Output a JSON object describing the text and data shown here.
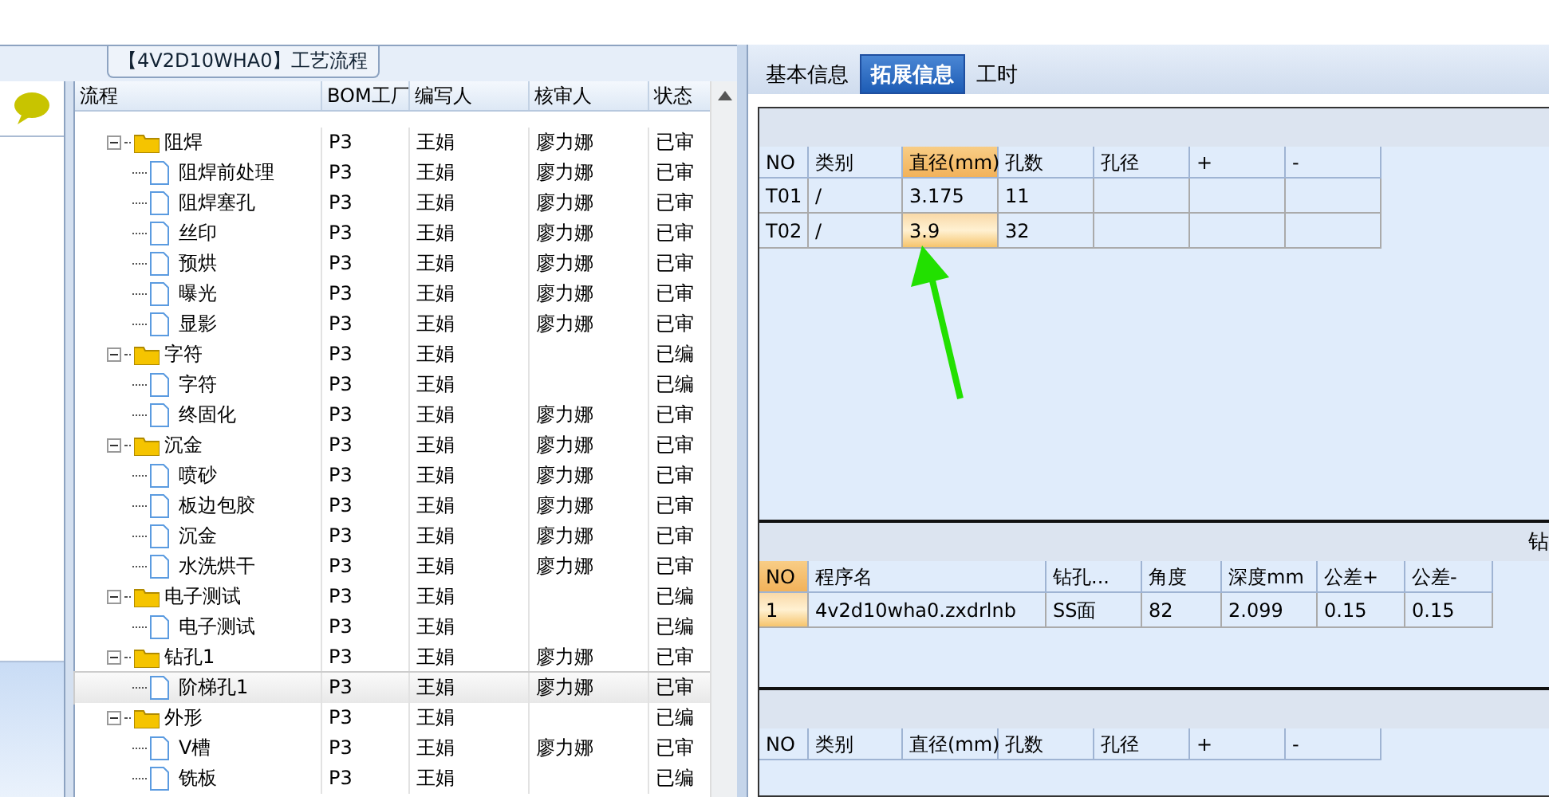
{
  "process_panel": {
    "title": "【4V2D10WHA0】工艺流程",
    "columns": [
      "流程",
      "BOM工厂",
      "编写人",
      "核审人",
      "状态"
    ],
    "tree": [
      {
        "name": "阻焊",
        "factory": "P3",
        "writer": "王娟",
        "reviewer": "廖力娜",
        "status": "已审",
        "expanded": true,
        "selected": false,
        "children": [
          {
            "name": "阻焊前处理",
            "factory": "P3",
            "writer": "王娟",
            "reviewer": "廖力娜",
            "status": "已审",
            "selected": false
          },
          {
            "name": "阻焊塞孔",
            "factory": "P3",
            "writer": "王娟",
            "reviewer": "廖力娜",
            "status": "已审",
            "selected": false
          },
          {
            "name": "丝印",
            "factory": "P3",
            "writer": "王娟",
            "reviewer": "廖力娜",
            "status": "已审",
            "selected": false
          },
          {
            "name": "预烘",
            "factory": "P3",
            "writer": "王娟",
            "reviewer": "廖力娜",
            "status": "已审",
            "selected": false
          },
          {
            "name": "曝光",
            "factory": "P3",
            "writer": "王娟",
            "reviewer": "廖力娜",
            "status": "已审",
            "selected": false
          },
          {
            "name": "显影",
            "factory": "P3",
            "writer": "王娟",
            "reviewer": "廖力娜",
            "status": "已审",
            "selected": false
          }
        ]
      },
      {
        "name": "字符",
        "factory": "P3",
        "writer": "王娟",
        "status": "已编",
        "expanded": true,
        "selected": false,
        "children": [
          {
            "name": "字符",
            "factory": "P3",
            "writer": "王娟",
            "status": "已编",
            "selected": false
          },
          {
            "name": "终固化",
            "factory": "P3",
            "writer": "王娟",
            "reviewer": "廖力娜",
            "status": "已审",
            "selected": false
          }
        ]
      },
      {
        "name": "沉金",
        "factory": "P3",
        "writer": "王娟",
        "reviewer": "廖力娜",
        "status": "已审",
        "expanded": true,
        "selected": false,
        "children": [
          {
            "name": "喷砂",
            "factory": "P3",
            "writer": "王娟",
            "reviewer": "廖力娜",
            "status": "已审",
            "selected": false
          },
          {
            "name": "板边包胶",
            "factory": "P3",
            "writer": "王娟",
            "reviewer": "廖力娜",
            "status": "已审",
            "selected": false
          },
          {
            "name": "沉金",
            "factory": "P3",
            "writer": "王娟",
            "reviewer": "廖力娜",
            "status": "已审",
            "selected": false
          },
          {
            "name": "水洗烘干",
            "factory": "P3",
            "writer": "王娟",
            "reviewer": "廖力娜",
            "status": "已审",
            "selected": false
          }
        ]
      },
      {
        "name": "电子测试",
        "factory": "P3",
        "writer": "王娟",
        "status": "已编",
        "expanded": true,
        "selected": false,
        "children": [
          {
            "name": "电子测试",
            "factory": "P3",
            "writer": "王娟",
            "status": "已编",
            "selected": false
          }
        ]
      },
      {
        "name": "钻孔1",
        "factory": "P3",
        "writer": "王娟",
        "reviewer": "廖力娜",
        "status": "已审",
        "expanded": true,
        "selected": false,
        "children": [
          {
            "name": "阶梯孔1",
            "factory": "P3",
            "writer": "王娟",
            "reviewer": "廖力娜",
            "status": "已审",
            "selected": true
          }
        ]
      },
      {
        "name": "外形",
        "factory": "P3",
        "writer": "王娟",
        "status": "已编",
        "expanded": true,
        "selected": false,
        "children": [
          {
            "name": "V槽",
            "factory": "P3",
            "writer": "王娟",
            "reviewer": "廖力娜",
            "status": "已审",
            "selected": false
          },
          {
            "name": "铣板",
            "factory": "P3",
            "writer": "王娟",
            "status": "已编",
            "selected": false
          }
        ]
      }
    ]
  },
  "tabs": [
    {
      "label": "基本信息",
      "selected": false
    },
    {
      "label": "拓展信息",
      "selected": true
    },
    {
      "label": "工时",
      "selected": false
    }
  ],
  "tool_table": {
    "columns": [
      {
        "label": "NO",
        "selected": false
      },
      {
        "label": "类别",
        "selected": false
      },
      {
        "label": "直径(mm)",
        "selected": true
      },
      {
        "label": "孔数",
        "selected": false
      },
      {
        "label": "孔径",
        "selected": false
      },
      {
        "label": "+",
        "selected": false
      },
      {
        "label": "-",
        "selected": false
      }
    ],
    "rows": [
      {
        "cells": [
          {
            "text": "T01",
            "selected": false
          },
          {
            "text": "/",
            "selected": false
          },
          {
            "text": "3.175",
            "selected": false
          },
          {
            "text": "11",
            "selected": false
          }
        ]
      },
      {
        "cells": [
          {
            "text": "T02",
            "selected": false
          },
          {
            "text": "/",
            "selected": false
          },
          {
            "text": "3.9",
            "selected": true
          },
          {
            "text": "32",
            "selected": false
          }
        ]
      }
    ]
  },
  "program_section": {
    "label": "钻",
    "columns": [
      {
        "label": "NO",
        "selected": true
      },
      {
        "label": "程序名",
        "selected": false
      },
      {
        "label": "钻孔...",
        "selected": false
      },
      {
        "label": "角度",
        "selected": false
      },
      {
        "label": "深度mm",
        "selected": false
      },
      {
        "label": "公差+",
        "selected": false
      },
      {
        "label": "公差-",
        "selected": false
      }
    ],
    "rows": [
      {
        "cells": [
          {
            "text": "1",
            "selected": true
          },
          {
            "text": "4v2d10wha0.zxdrlnb",
            "selected": false
          },
          {
            "text": "SS面",
            "selected": false
          },
          {
            "text": "82",
            "selected": false
          },
          {
            "text": "2.099",
            "selected": false
          },
          {
            "text": "0.15",
            "selected": false
          },
          {
            "text": "0.15",
            "selected": false
          }
        ]
      }
    ]
  },
  "bottom_table": {
    "columns": [
      {
        "label": "NO",
        "selected": false
      },
      {
        "label": "类别",
        "selected": false
      },
      {
        "label": "直径(mm)",
        "selected": false
      },
      {
        "label": "孔数",
        "selected": false
      },
      {
        "label": "孔径",
        "selected": false
      },
      {
        "label": "+",
        "selected": false
      },
      {
        "label": "-",
        "selected": false
      }
    ]
  }
}
